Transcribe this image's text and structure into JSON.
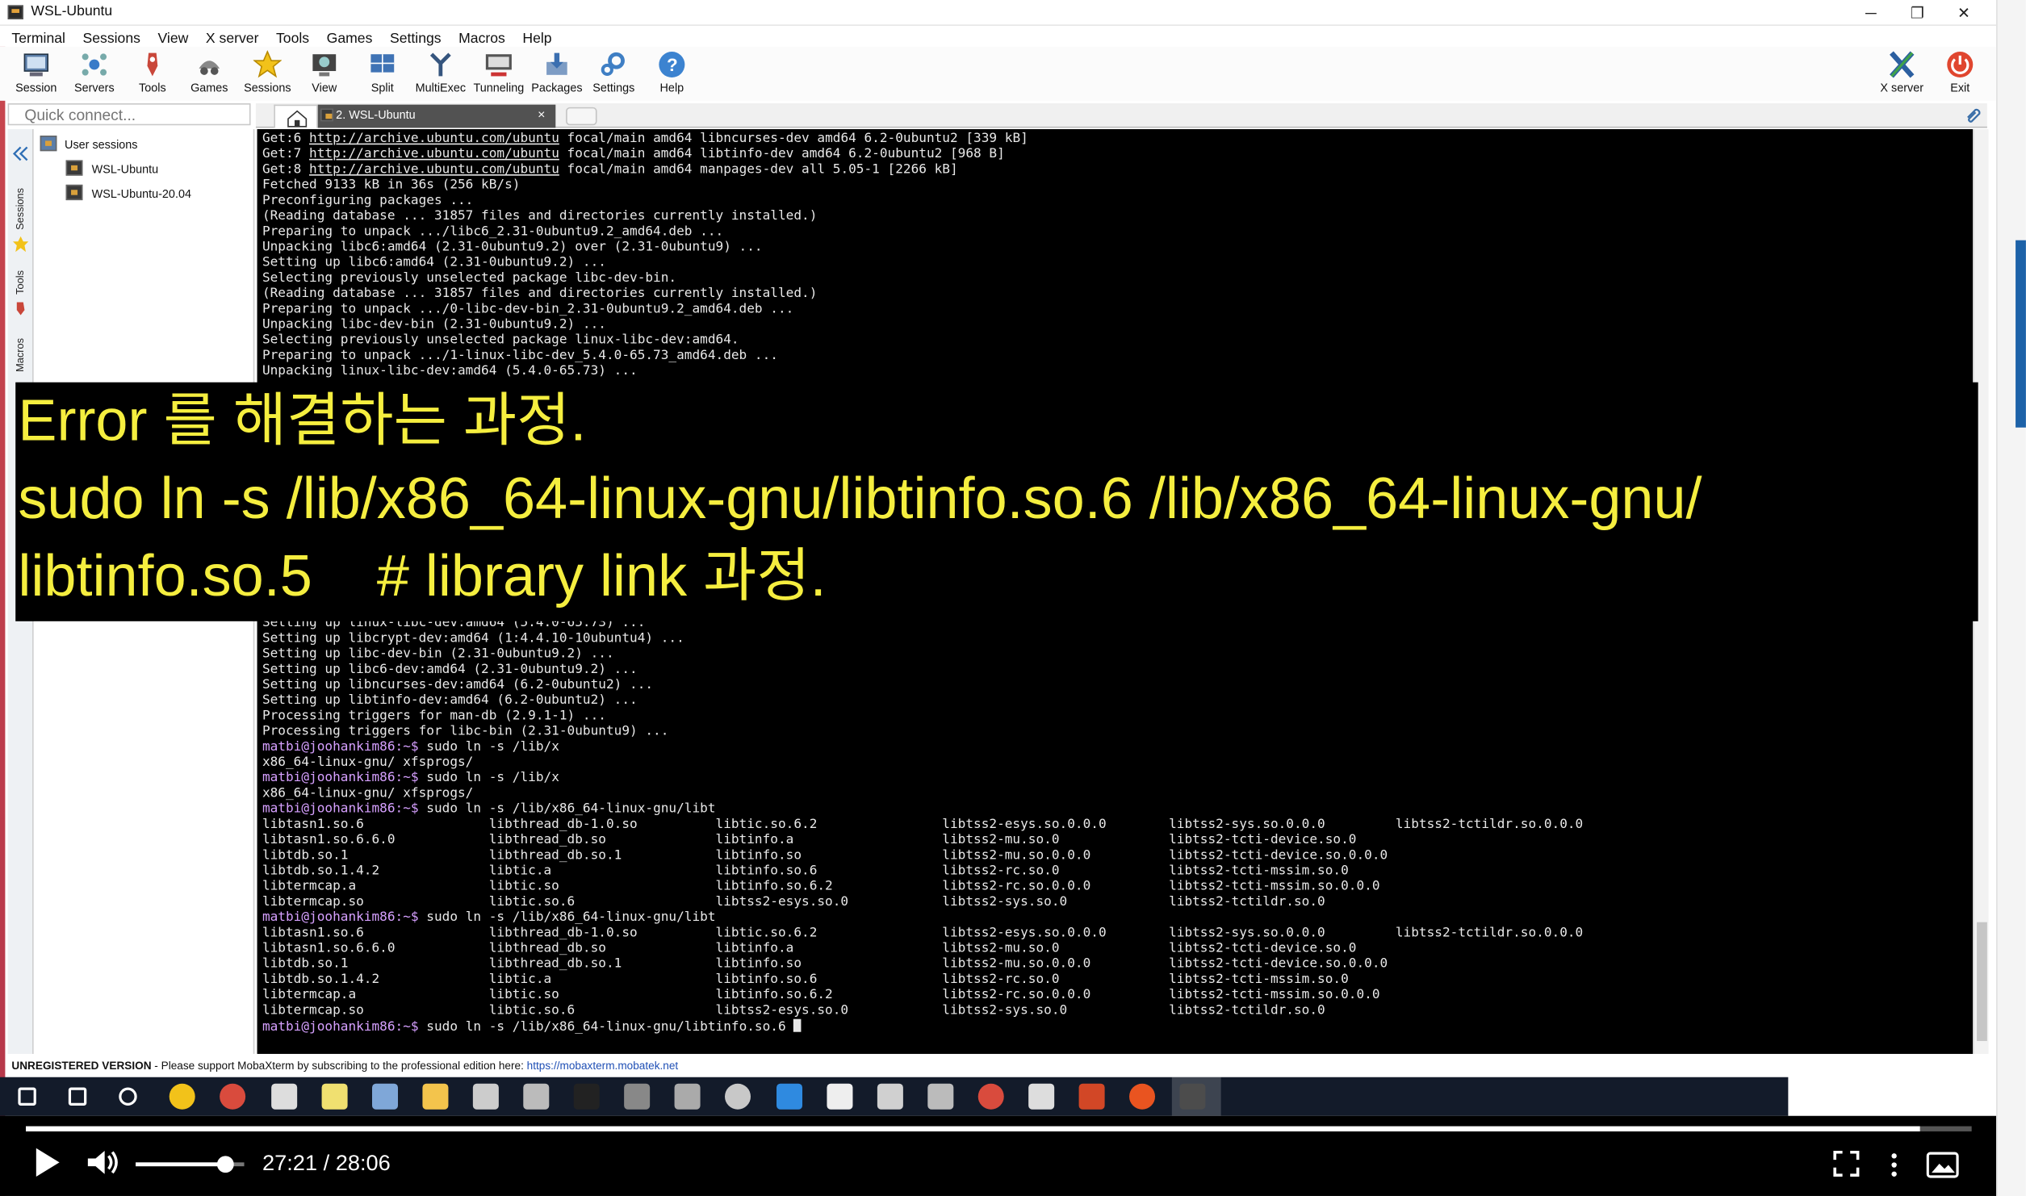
{
  "window": {
    "title": "WSL-Ubuntu",
    "minimize": "─",
    "restore": "❐",
    "close": "✕"
  },
  "menu": [
    "Terminal",
    "Sessions",
    "View",
    "X server",
    "Tools",
    "Games",
    "Settings",
    "Macros",
    "Help"
  ],
  "toolbar": {
    "buttons": [
      "Session",
      "Servers",
      "Tools",
      "Games",
      "Sessions",
      "View",
      "Split",
      "MultiExec",
      "Tunneling",
      "Packages",
      "Settings",
      "Help"
    ],
    "right_buttons": [
      "X server",
      "Exit"
    ]
  },
  "quick_connect": {
    "placeholder": "Quick connect..."
  },
  "side_tabs": [
    "Sessions",
    "Tools",
    "Macros"
  ],
  "sessions": {
    "root": "User sessions",
    "items": [
      "WSL-Ubuntu",
      "WSL-Ubuntu-20.04"
    ]
  },
  "tabs": {
    "active": "2. WSL-Ubuntu",
    "close": "×"
  },
  "terminal": {
    "top_lines": [
      [
        {
          "t": "Get:6 "
        },
        {
          "t": "http://archive.ubuntu.com/ubuntu",
          "c": "u"
        },
        {
          "t": " focal/main amd64 libncurses-dev amd64 6.2-0ubuntu2 [339 kB]"
        }
      ],
      [
        {
          "t": "Get:7 "
        },
        {
          "t": "http://archive.ubuntu.com/ubuntu",
          "c": "u"
        },
        {
          "t": " focal/main amd64 libtinfo-dev amd64 6.2-0ubuntu2 [968 B]"
        }
      ],
      [
        {
          "t": "Get:8 "
        },
        {
          "t": "http://archive.ubuntu.com/ubuntu",
          "c": "u"
        },
        {
          "t": " focal/main amd64 manpages-dev all 5.05-1 [2266 kB]"
        }
      ],
      [
        {
          "t": "Fetched 9133 kB in 36s (256 kB/s)"
        }
      ],
      [
        {
          "t": "Preconfiguring packages ..."
        }
      ],
      [
        {
          "t": "(Reading database ... 31857 files and directories currently installed.)"
        }
      ],
      [
        {
          "t": "Preparing to unpack .../libc6_2.31-0ubuntu9.2_amd64.deb ..."
        }
      ],
      [
        {
          "t": "Unpacking libc6:amd64 (2.31-0ubuntu9.2) over (2.31-0ubuntu9) ..."
        }
      ],
      [
        {
          "t": "Setting up libc6:amd64 (2.31-0ubuntu9.2) ..."
        }
      ],
      [
        {
          "t": "Selecting previously unselected package libc-dev-bin."
        }
      ],
      [
        {
          "t": "(Reading database ... 31857 files and directories currently installed.)"
        }
      ],
      [
        {
          "t": "Preparing to unpack .../0-libc-dev-bin_2.31-0ubuntu9.2_amd64.deb ..."
        }
      ],
      [
        {
          "t": "Unpacking libc-dev-bin (2.31-0ubuntu9.2) ..."
        }
      ],
      [
        {
          "t": "Selecting previously unselected package linux-libc-dev:amd64."
        }
      ],
      [
        {
          "t": "Preparing to unpack .../1-linux-libc-dev_5.4.0-65.73_amd64.deb ..."
        }
      ],
      [
        {
          "t": "Unpacking linux-libc-dev:amd64 (5.4.0-65.73) ..."
        }
      ]
    ],
    "bottom_lines": [
      [
        {
          "t": "Setting up linux-libc-dev:amd64 (5.4.0-65.73) ..."
        }
      ],
      [
        {
          "t": "Setting up libcrypt-dev:amd64 (1:4.4.10-10ubuntu4) ..."
        }
      ],
      [
        {
          "t": "Setting up libc-dev-bin (2.31-0ubuntu9.2) ..."
        }
      ],
      [
        {
          "t": "Setting up libc6-dev:amd64 (2.31-0ubuntu9.2) ..."
        }
      ],
      [
        {
          "t": "Setting up libncurses-dev:amd64 (6.2-0ubuntu2) ..."
        }
      ],
      [
        {
          "t": "Setting up libtinfo-dev:amd64 (6.2-0ubuntu2) ..."
        }
      ],
      [
        {
          "t": "Processing triggers for man-db (2.9.1-1) ..."
        }
      ],
      [
        {
          "t": "Processing triggers for libc-bin (2.31-0ubuntu9) ..."
        }
      ],
      [
        {
          "t": "matbi@joohankim86:~$",
          "c": "p"
        },
        {
          "t": " sudo ln -s /lib/x"
        }
      ],
      [
        {
          "t": "x86_64-linux-gnu/ xfsprogs/"
        }
      ],
      [
        {
          "t": "matbi@joohankim86:~$",
          "c": "p"
        },
        {
          "t": " sudo ln -s /lib/x"
        }
      ],
      [
        {
          "t": "x86_64-linux-gnu/ xfsprogs/"
        }
      ],
      [
        {
          "t": "matbi@joohankim86:~$",
          "c": "p"
        },
        {
          "t": " sudo ln -s /lib/x86_64-linux-gnu/libt"
        }
      ],
      [
        {
          "t": "libtasn1.so.6                libthread_db-1.0.so          libtic.so.6.2                libtss2-esys.so.0.0.0        libtss2-sys.so.0.0.0         libtss2-tctildr.so.0.0.0"
        }
      ],
      [
        {
          "t": "libtasn1.so.6.6.0            libthread_db.so              libtinfo.a                   libtss2-mu.so.0              libtss2-tcti-device.so.0"
        }
      ],
      [
        {
          "t": "libtdb.so.1                  libthread_db.so.1            libtinfo.so                  libtss2-mu.so.0.0.0          libtss2-tcti-device.so.0.0.0"
        }
      ],
      [
        {
          "t": "libtdb.so.1.4.2              libtic.a                     libtinfo.so.6                libtss2-rc.so.0              libtss2-tcti-mssim.so.0"
        }
      ],
      [
        {
          "t": "libtermcap.a                 libtic.so                    libtinfo.so.6.2              libtss2-rc.so.0.0.0          libtss2-tcti-mssim.so.0.0.0"
        }
      ],
      [
        {
          "t": "libtermcap.so                libtic.so.6                  libtss2-esys.so.0            libtss2-sys.so.0             libtss2-tctildr.so.0"
        }
      ],
      [
        {
          "t": "matbi@joohankim86:~$",
          "c": "p"
        },
        {
          "t": " sudo ln -s /lib/x86_64-linux-gnu/libt"
        }
      ],
      [
        {
          "t": "libtasn1.so.6                libthread_db-1.0.so          libtic.so.6.2                libtss2-esys.so.0.0.0        libtss2-sys.so.0.0.0         libtss2-tctildr.so.0.0.0"
        }
      ],
      [
        {
          "t": "libtasn1.so.6.6.0            libthread_db.so              libtinfo.a                   libtss2-mu.so.0              libtss2-tcti-device.so.0"
        }
      ],
      [
        {
          "t": "libtdb.so.1                  libthread_db.so.1            libtinfo.so                  libtss2-mu.so.0.0.0          libtss2-tcti-device.so.0.0.0"
        }
      ],
      [
        {
          "t": "libtdb.so.1.4.2              libtic.a                     libtinfo.so.6                libtss2-rc.so.0              libtss2-tcti-mssim.so.0"
        }
      ],
      [
        {
          "t": "libtermcap.a                 libtic.so                    libtinfo.so.6.2              libtss2-rc.so.0.0.0          libtss2-tcti-mssim.so.0.0.0"
        }
      ],
      [
        {
          "t": "libtermcap.so                libtic.so.6                  libtss2-esys.so.0            libtss2-sys.so.0             libtss2-tctildr.so.0"
        }
      ],
      [
        {
          "t": "matbi@joohankim86:~$",
          "c": "p"
        },
        {
          "t": " sudo ln -s /lib/x86_64-linux-gnu/libtinfo.so.6 "
        },
        {
          "t": "",
          "c": "cursor"
        }
      ]
    ]
  },
  "caption": {
    "line1": "Error 를 해결하는 과정.",
    "line2": "sudo ln -s /lib/x86_64-linux-gnu/libtinfo.so.6 /lib/x86_64-linux-gnu/",
    "line3": "libtinfo.so.5    # library link 과정."
  },
  "status": {
    "unregistered": "UNREGISTERED VERSION",
    "message": "  -  Please support MobaXterm by subscribing to the professional edition here: ",
    "link": "https://mobaxterm.mobatek.net"
  },
  "taskbar": [
    "windows-start",
    "search",
    "task-view",
    "player",
    "chrome",
    "settings",
    "sticky",
    "pen",
    "explorer",
    "xming",
    "paint",
    "terminal",
    "calculator",
    "clock",
    "dolphin",
    "vscode",
    "slack",
    "camera",
    "hedgehog",
    "chrome-2",
    "store",
    "powerpoint",
    "ubuntu",
    "mobaxterm"
  ],
  "player": {
    "time": "27:21 / 28:06",
    "progress": 0.9733,
    "volume": 0.82
  },
  "colors": {
    "caption_text": "#f5ee3f",
    "prompt": "#d6a0ff",
    "toolbar_accent": "#1f6fc1"
  }
}
